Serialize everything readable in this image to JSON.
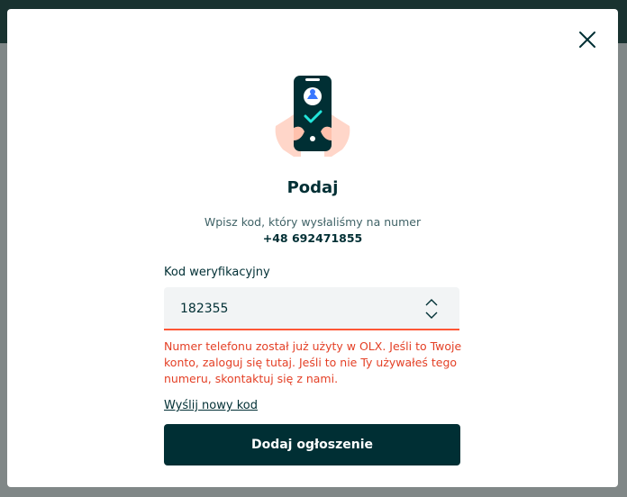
{
  "background": {
    "header_color": "#17302e"
  },
  "modal": {
    "title": "Podaj",
    "subtitle": "Wpisz kod, który wysłaliśmy na numer",
    "phone": "+48 692471855",
    "field_label": "Kod weryfikacyjny",
    "code_value": "182355",
    "error_message": "Numer telefonu został już użyty w OLX. Jeśli to Twoje konto, zaloguj się tutaj. Jeśli to nie Ty używałeś tego numeru, skontaktuj się z nami.",
    "resend_link": "Wyślij nowy kod",
    "submit_label": "Dodaj ogłoszenie"
  },
  "colors": {
    "primary": "#002f34",
    "error": "#e44026",
    "accent": "#23e5db"
  },
  "icons": {
    "close": "close-icon",
    "illustration": "phone-verification-illustration",
    "stepper_up": "chevron-up-icon",
    "stepper_down": "chevron-down-icon"
  }
}
